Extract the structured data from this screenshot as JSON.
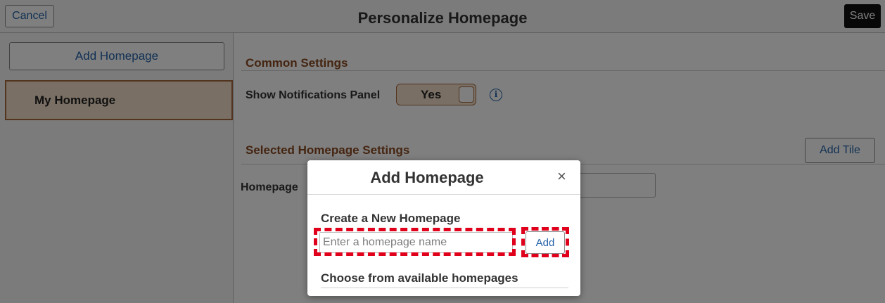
{
  "header": {
    "cancel_label": "Cancel",
    "title": "Personalize Homepage",
    "save_label": "Save"
  },
  "sidebar": {
    "add_homepage_label": "Add Homepage",
    "items": [
      {
        "label": "My Homepage",
        "selected": true
      }
    ]
  },
  "main": {
    "common_settings": {
      "title": "Common Settings",
      "notifications_label": "Show Notifications Panel",
      "toggle_value": "Yes",
      "info_icon": "info-icon"
    },
    "selected_settings": {
      "title": "Selected Homepage Settings",
      "add_tile_label": "Add Tile",
      "homepage_label": "Homepage"
    }
  },
  "modal": {
    "title": "Add Homepage",
    "close_glyph": "×",
    "create_title": "Create a New Homepage",
    "input_placeholder": "Enter a homepage name",
    "input_value": "",
    "add_label": "Add",
    "choose_title": "Choose from available homepages"
  },
  "colors": {
    "accent_link": "#2563a8",
    "section_title": "#8a4a22",
    "selected_bg": "#f3dfc8",
    "selected_border": "#a4683f",
    "highlight": "#e0001b"
  }
}
